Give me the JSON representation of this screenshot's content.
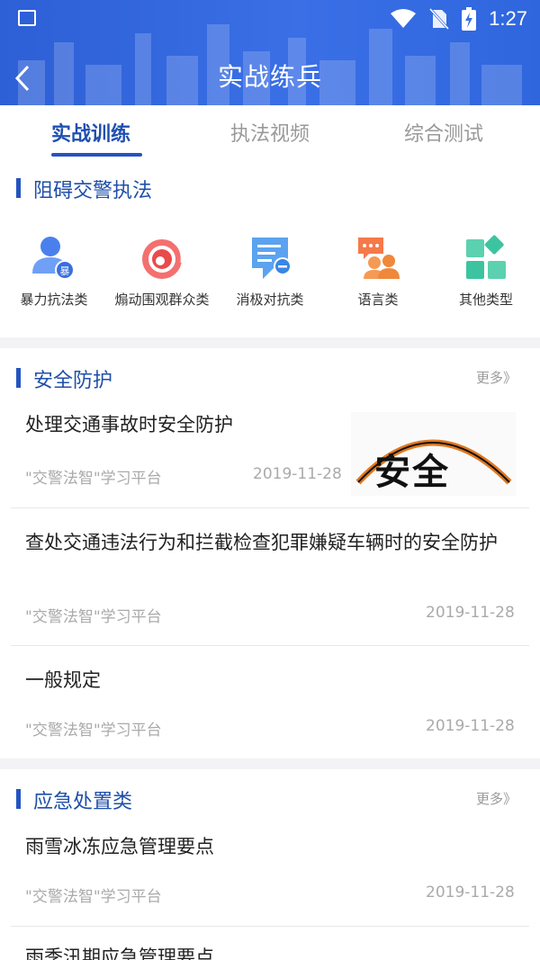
{
  "status_bar": {
    "time": "1:27"
  },
  "header": {
    "title": "实战练兵"
  },
  "tabs": [
    {
      "label": "实战训练"
    },
    {
      "label": "执法视频"
    },
    {
      "label": "综合测试"
    }
  ],
  "section_obstruct": {
    "title": "阻碍交警执法",
    "categories": [
      {
        "label": "暴力抗法类",
        "icon": "person-badge-icon",
        "badge_text": "暴"
      },
      {
        "label": "煽动围观群众类",
        "icon": "signal-icon"
      },
      {
        "label": "消极对抗类",
        "icon": "document-minus-icon"
      },
      {
        "label": "语言类",
        "icon": "chat-people-icon"
      },
      {
        "label": "其他类型",
        "icon": "grid-icon"
      }
    ]
  },
  "section_safety": {
    "title": "安全防护",
    "more": "更多》",
    "items": [
      {
        "title": "处理交通事故时安全防护",
        "source": "\"交警法智\"学习平台",
        "date": "2019-11-28",
        "thumb_text": "安全"
      },
      {
        "title": "查处交通违法行为和拦截检查犯罪嫌疑车辆时的安全防护",
        "source": "\"交警法智\"学习平台",
        "date": "2019-11-28"
      },
      {
        "title": "一般规定",
        "source": "\"交警法智\"学习平台",
        "date": "2019-11-28"
      }
    ]
  },
  "section_emergency": {
    "title": "应急处置类",
    "more": "更多》",
    "items": [
      {
        "title": "雨雪冰冻应急管理要点",
        "source": "\"交警法智\"学习平台",
        "date": "2019-11-28"
      },
      {
        "title": "雨季汛期应急管理要点"
      }
    ]
  },
  "colors": {
    "primary": "#2454c0",
    "header": "#3366e0",
    "accent_red": "#e94b4b",
    "accent_orange": "#f0883c",
    "accent_green": "#3cc4a0"
  }
}
